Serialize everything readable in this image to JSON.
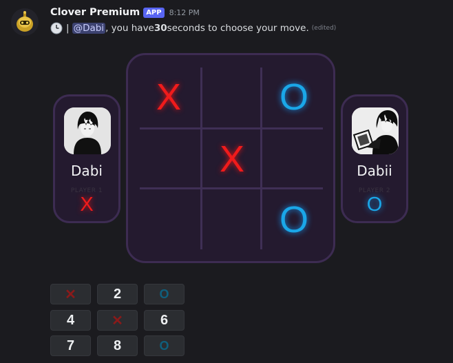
{
  "message": {
    "author": "Clover Premium",
    "badge": "APP",
    "timestamp": "8:12 PM",
    "separator": "|",
    "mention": "@Dabi",
    "text_before_bold": ", you have ",
    "bold_value": "30",
    "text_after_bold": " seconds to choose your move.",
    "edited_tag": "(edited)"
  },
  "board": {
    "cells": [
      "X",
      "",
      "O",
      "",
      "X",
      "",
      "",
      "",
      "O"
    ]
  },
  "players": [
    {
      "name": "Dabi",
      "label": "PLAYER 1",
      "mark": "X",
      "avatar_icon": "dark-haired-character-avatar-icon"
    },
    {
      "name": "Dabii",
      "label": "PLAYER 2",
      "mark": "O",
      "avatar_icon": "character-holding-photo-avatar-icon"
    }
  ],
  "buttons": [
    {
      "type": "x",
      "label": "✕"
    },
    {
      "type": "num",
      "label": "2"
    },
    {
      "type": "o",
      "label": "O"
    },
    {
      "type": "num",
      "label": "4"
    },
    {
      "type": "x",
      "label": "✕"
    },
    {
      "type": "num",
      "label": "6"
    },
    {
      "type": "num",
      "label": "7"
    },
    {
      "type": "num",
      "label": "8"
    },
    {
      "type": "o",
      "label": "O"
    }
  ],
  "colors": {
    "x_mark": "#f01b1b",
    "o_mark": "#1aa7e8",
    "panel_bg": "#241a2f",
    "panel_border": "#3d2c52",
    "badge": "#5865f2"
  }
}
